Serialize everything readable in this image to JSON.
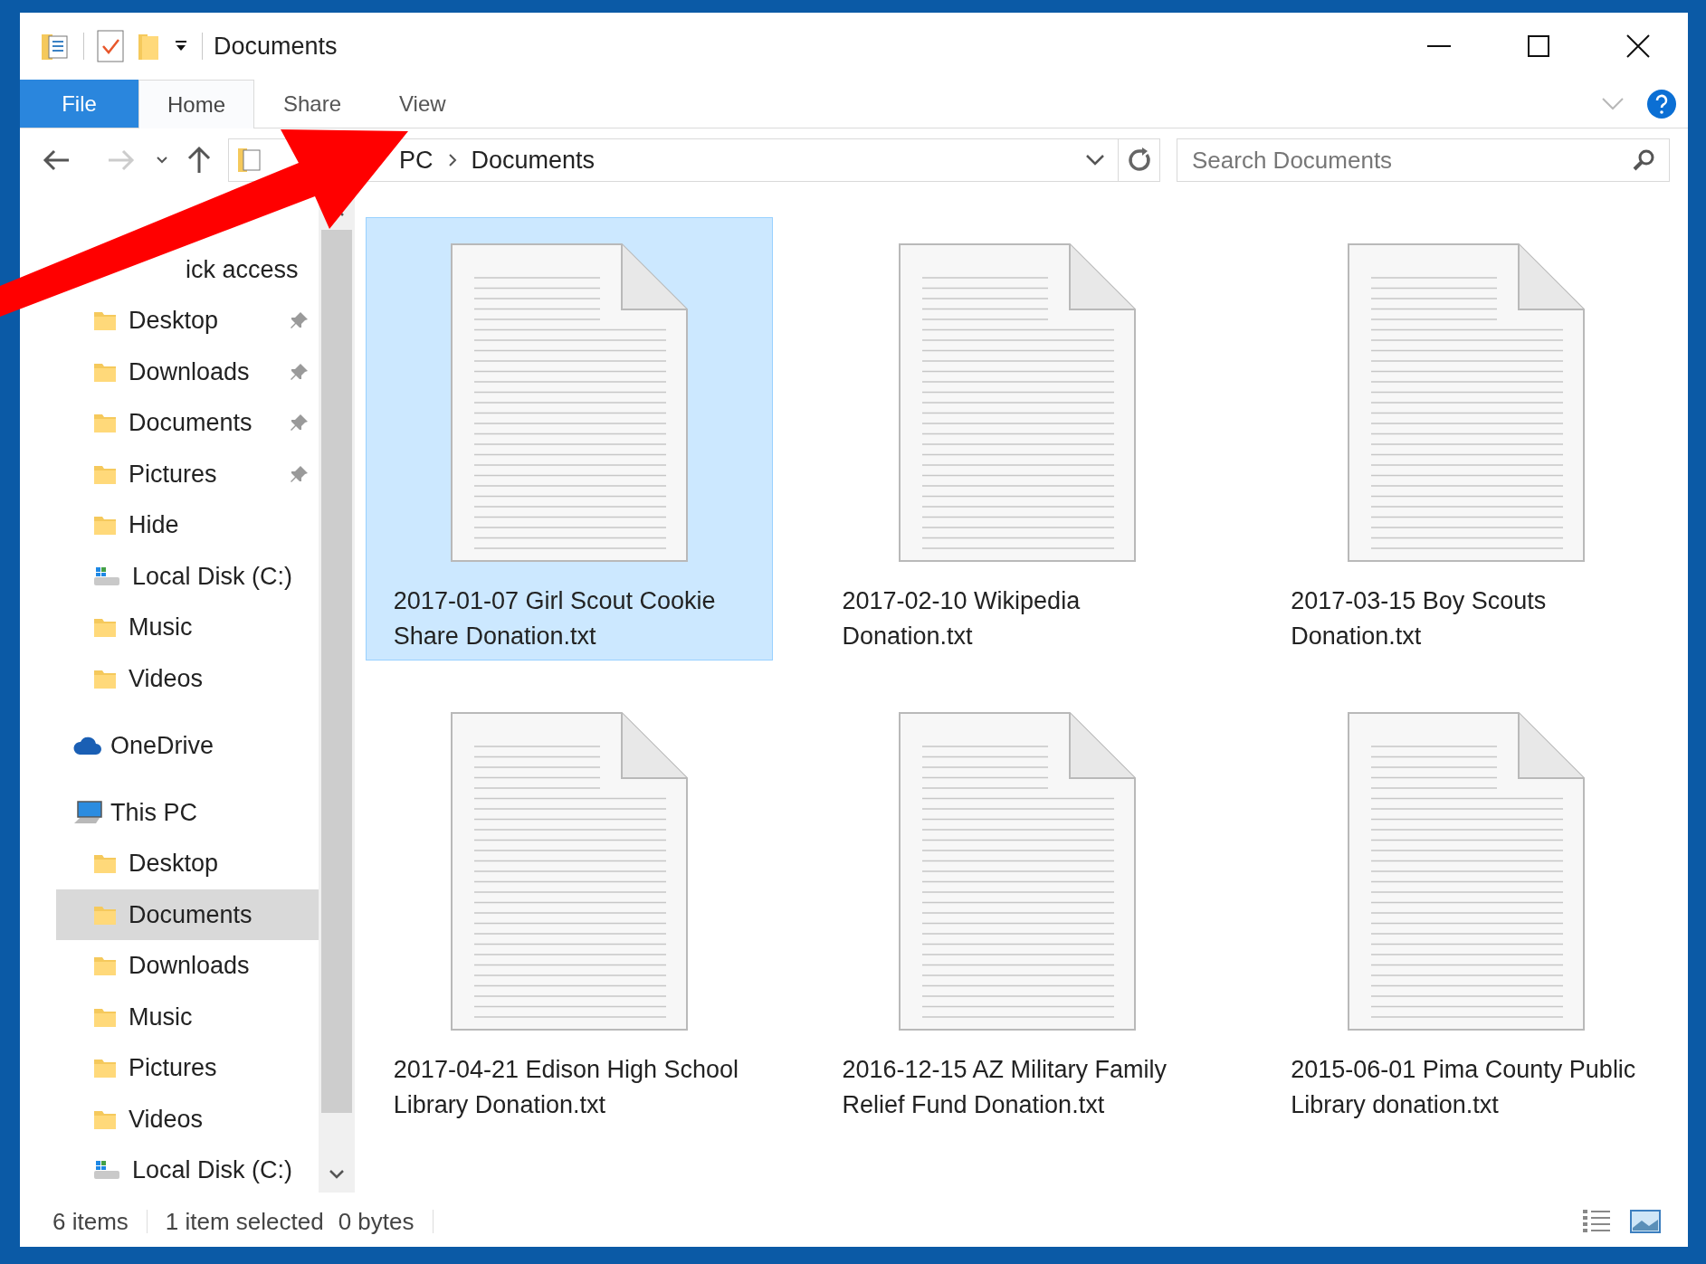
{
  "window": {
    "title": "Documents"
  },
  "ribbon_tabs": [
    {
      "label": "File",
      "kind": "file",
      "selected": false
    },
    {
      "label": "Home",
      "kind": "tab",
      "selected": true
    },
    {
      "label": "Share",
      "kind": "tab",
      "selected": false
    },
    {
      "label": "View",
      "kind": "tab",
      "selected": false
    }
  ],
  "address_bar": {
    "path": [
      {
        "label": "PC"
      },
      {
        "label": "Documents"
      }
    ]
  },
  "search": {
    "placeholder": "Search Documents"
  },
  "navigation": [
    {
      "label": "ick access",
      "children": [
        {
          "label": "Desktop",
          "kind": "folder",
          "pinned": true,
          "selected": false
        },
        {
          "label": "Downloads",
          "kind": "folder",
          "pinned": true,
          "selected": false
        },
        {
          "label": "Documents",
          "kind": "folder",
          "pinned": true,
          "selected": false
        },
        {
          "label": "Pictures",
          "kind": "folder",
          "pinned": true,
          "selected": false
        },
        {
          "label": "Hide",
          "kind": "folder",
          "pinned": false,
          "selected": false
        },
        {
          "label": "Local Disk (C:)",
          "kind": "drive",
          "pinned": false,
          "selected": false
        },
        {
          "label": "Music",
          "kind": "folder",
          "pinned": false,
          "selected": false
        },
        {
          "label": "Videos",
          "kind": "folder",
          "pinned": false,
          "selected": false
        }
      ]
    },
    {
      "label": "OneDrive",
      "kind": "cloud"
    },
    {
      "label": "This PC",
      "kind": "computer",
      "children": [
        {
          "label": "Desktop",
          "kind": "folder",
          "pinned": false,
          "selected": false
        },
        {
          "label": "Documents",
          "kind": "folder",
          "pinned": false,
          "selected": true
        },
        {
          "label": "Downloads",
          "kind": "folder",
          "pinned": false,
          "selected": false
        },
        {
          "label": "Music",
          "kind": "folder",
          "pinned": false,
          "selected": false
        },
        {
          "label": "Pictures",
          "kind": "folder",
          "pinned": false,
          "selected": false
        },
        {
          "label": "Videos",
          "kind": "folder",
          "pinned": false,
          "selected": false
        },
        {
          "label": "Local Disk (C:)",
          "kind": "drive",
          "pinned": false,
          "selected": false
        }
      ]
    }
  ],
  "files": [
    {
      "name": "2017-01-07 Girl Scout Cookie Share Donation.txt",
      "selected": true
    },
    {
      "name": "2017-02-10 Wikipedia Donation.txt",
      "selected": false
    },
    {
      "name": "2017-03-15 Boy Scouts Donation.txt",
      "selected": false
    },
    {
      "name": "2017-04-21 Edison High School Library Donation.txt",
      "selected": false
    },
    {
      "name": "2016-12-15 AZ Military Family Relief Fund Donation.txt",
      "selected": false
    },
    {
      "name": "2015-06-01 Pima County Public Library donation.txt",
      "selected": false
    }
  ],
  "status_bar": {
    "item_count": "6 items",
    "selection": "1 item selected",
    "size": "0 bytes"
  }
}
